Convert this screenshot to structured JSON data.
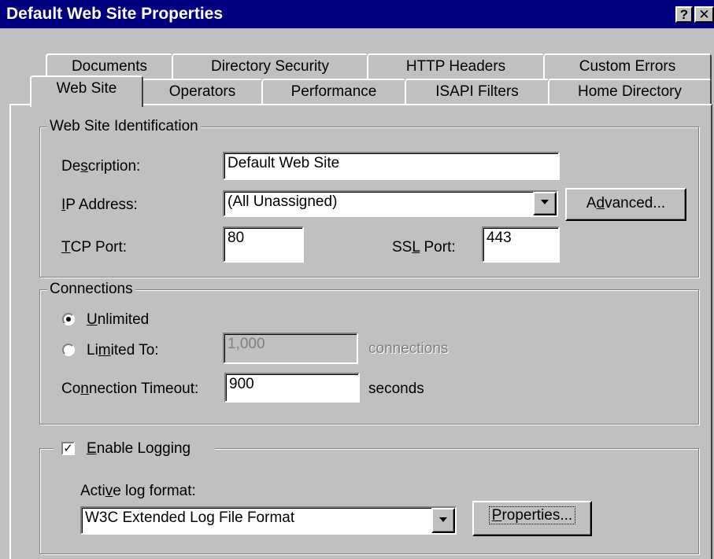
{
  "window": {
    "title": "Default Web Site Properties",
    "help_glyph": "?",
    "close_glyph": "✕"
  },
  "tabs": {
    "row1": [
      "Documents",
      "Directory Security",
      "HTTP Headers",
      "Custom Errors"
    ],
    "row2": [
      "Web Site",
      "Operators",
      "Performance",
      "ISAPI Filters",
      "Home Directory"
    ],
    "active": "Web Site"
  },
  "identification": {
    "legend": "Web Site Identification",
    "description_label": "Description:",
    "description_value": "Default Web Site",
    "ip_label": "IP Address:",
    "ip_value": "(All Unassigned)",
    "advanced_label": "Advanced...",
    "tcp_label": "TCP Port:",
    "tcp_value": "80",
    "ssl_label": "SSL Port:",
    "ssl_value": "443"
  },
  "connections": {
    "legend": "Connections",
    "unlimited_label": "Unlimited",
    "unlimited_selected": true,
    "limited_label": "Limited To:",
    "limited_value": "1,000",
    "connections_unit": "connections",
    "timeout_label": "Connection Timeout:",
    "timeout_value": "900",
    "timeout_unit": "seconds"
  },
  "logging": {
    "enable_label": "Enable Logging",
    "enabled": true,
    "format_label": "Active log format:",
    "format_value": "W3C Extended Log File Format",
    "properties_label": "Properties..."
  }
}
